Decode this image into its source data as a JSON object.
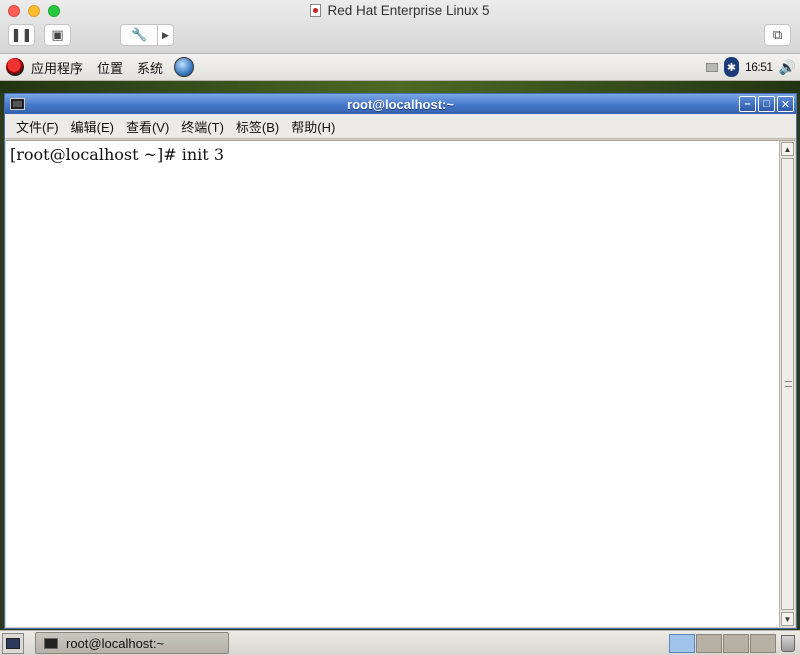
{
  "host": {
    "window_title": "Red Hat Enterprise Linux 5"
  },
  "gnome_panel": {
    "menus": [
      "应用程序",
      "位置",
      "系统"
    ],
    "clock": "16:51"
  },
  "terminal": {
    "title": "root@localhost:~",
    "menus": [
      "文件(F)",
      "编辑(E)",
      "查看(V)",
      "终端(T)",
      "标签(B)",
      "帮助(H)"
    ],
    "content": "[root@localhost ~]# init 3"
  },
  "taskbar": {
    "task_label": "root@localhost:~",
    "workspaces": 4,
    "active_workspace": 1
  }
}
